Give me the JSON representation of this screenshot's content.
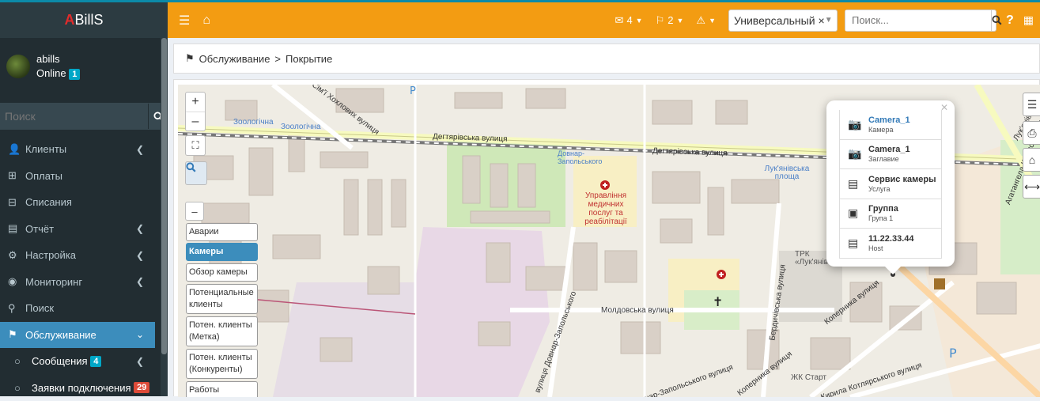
{
  "logo": {
    "first": "A",
    "rest": "BillS"
  },
  "user": {
    "name": "abills",
    "status": "Online",
    "count": "1"
  },
  "sidebar_search": {
    "placeholder": "Поиск"
  },
  "menu": [
    {
      "label": "Клиенты",
      "icon": "user-icon"
    },
    {
      "label": "Оплаты",
      "icon": "plus-square-icon"
    },
    {
      "label": "Списания",
      "icon": "minus-square-icon"
    },
    {
      "label": "Отчёт",
      "icon": "bar-chart-icon"
    },
    {
      "label": "Настройка",
      "icon": "gear-icon"
    },
    {
      "label": "Мониторинг",
      "icon": "eye-icon"
    },
    {
      "label": "Поиск",
      "icon": "search-icon"
    },
    {
      "label": "Обслуживание",
      "icon": "flag-icon"
    },
    {
      "label": "Сообщения",
      "icon": "circle-icon",
      "badge": "4"
    },
    {
      "label": "Заявки подключения",
      "icon": "circle-icon",
      "badge": "29"
    }
  ],
  "header": {
    "mail_count": "4",
    "flag_count": "2",
    "select_value": "Универсальный",
    "search_placeholder": "Поиск..."
  },
  "breadcrumb": {
    "part1": "Обслуживание",
    "sep": ">",
    "part2": "Покрытие"
  },
  "map": {
    "zoom_in": "+",
    "zoom_out": "–",
    "collapse": "–",
    "layers": [
      "Аварии",
      "Камеры",
      "Обзор камеры",
      "Потенциальные клиенты",
      "Потен. клиенты (Метка)",
      "Потен. клиенты (Конкуренты)",
      "Работы"
    ],
    "labels": {
      "street1": "Дегтярівська вулиця",
      "street2": "Дегтярівська вулиця",
      "street3": "Сім'ї Хохлових вулиця",
      "street4": "Молдовська вулиця",
      "street5": "Бердичівська вулиця",
      "street6": "Коперника вулиця",
      "street7": "Коперника вулиця",
      "street8": "Агатангела Кримського вулиця",
      "street9": "вулиця Довнар-Запольського",
      "street10": "Довнар-Запольського вулиця",
      "zoo1": "Зоологічна",
      "zoo2": "Зоологічна",
      "dovnar": "Довнар-Запольського",
      "lukyan": "Лук'янівська площа",
      "trk": "ТРК «Лук'янівка»",
      "zhk": "ЖК Старт",
      "hosp": "Управління медичних послуг та реабілітації",
      "kotlyar": "Кирила Котлярського вулиця",
      "lukyan2": "Лук'янівська"
    }
  },
  "popup": {
    "rows": [
      {
        "title": "Camera_1",
        "sub": "Камера",
        "icon": "camera-icon",
        "link": true
      },
      {
        "title": "Camera_1",
        "sub": "Заглавие",
        "icon": "camera-icon",
        "link": false
      },
      {
        "title": "Сервис камеры",
        "sub": "Услуга",
        "icon": "service-icon",
        "link": false
      },
      {
        "title": "Группа",
        "sub": "Група 1",
        "icon": "group-icon",
        "link": false
      },
      {
        "title": "11.22.33.44",
        "sub": "Host",
        "icon": "server-icon",
        "link": false
      }
    ]
  },
  "colors": {
    "header": "#f39c12",
    "sidebar": "#222d32",
    "active": "#3c8dbc"
  }
}
